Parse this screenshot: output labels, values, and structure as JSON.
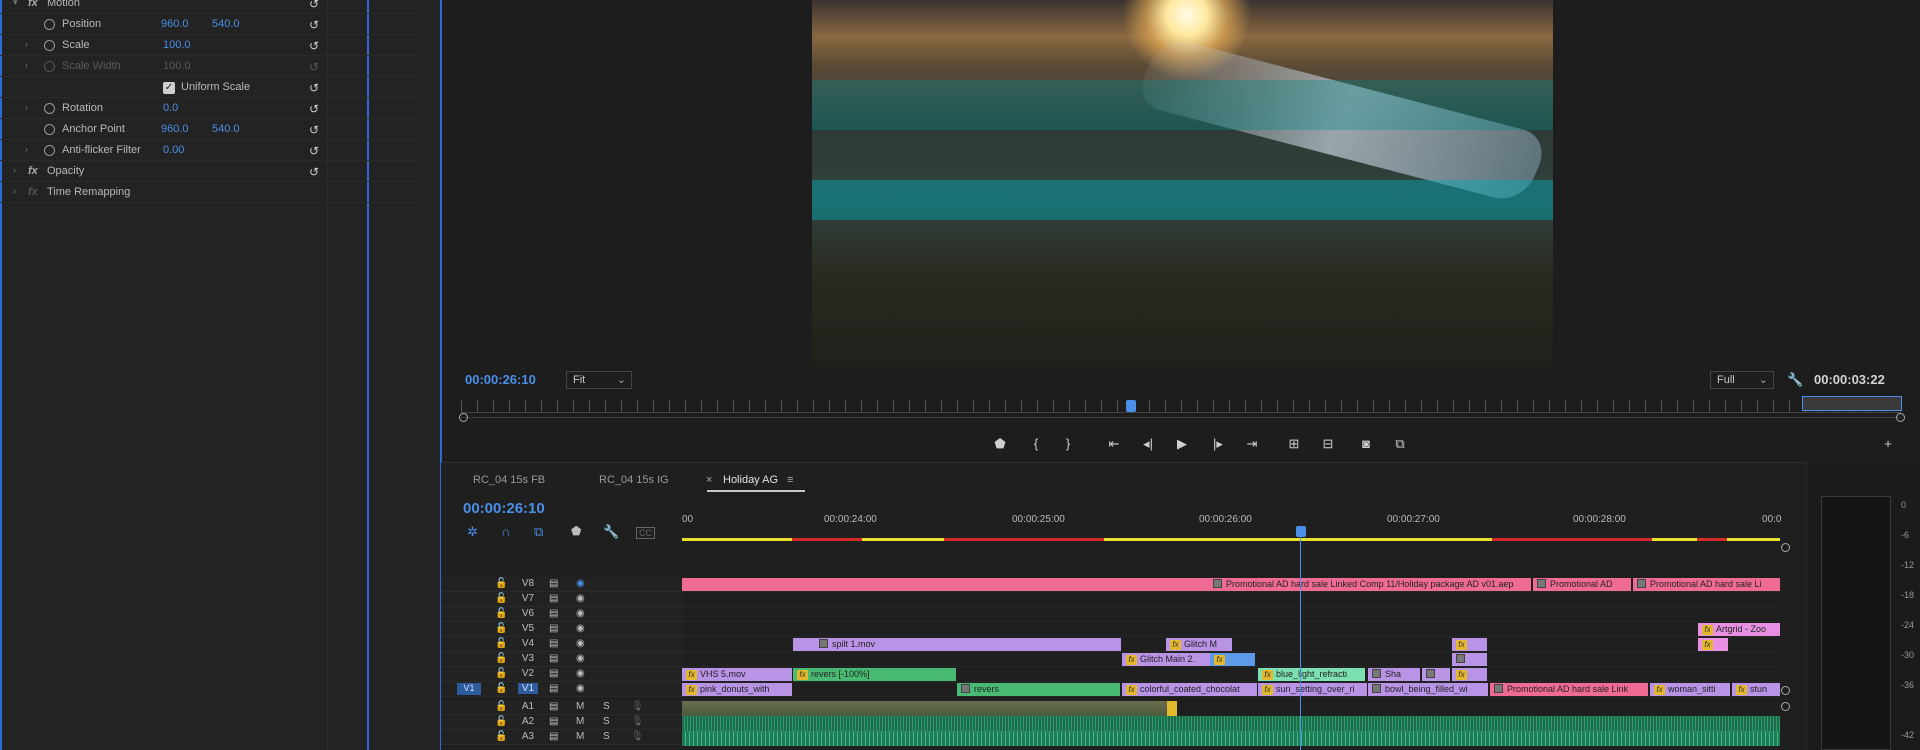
{
  "effect_controls": {
    "motion": {
      "label": "Motion"
    },
    "properties": [
      {
        "label": "Position",
        "value1": "960.0",
        "value2": "540.0"
      },
      {
        "label": "Scale",
        "value1": "100.0"
      },
      {
        "label": "Scale Width",
        "value1": "100.0"
      },
      {
        "label": "Uniform Scale"
      },
      {
        "label": "Rotation",
        "value1": "0.0"
      },
      {
        "label": "Anchor Point",
        "value1": "960.0",
        "value2": "540.0"
      },
      {
        "label": "Anti-flicker Filter",
        "value1": "0.00"
      }
    ],
    "opacity_label": "Opacity",
    "time_remap_label": "Time Remapping"
  },
  "program": {
    "current_tc": "00:00:26:10",
    "fit_select": "Fit",
    "quality_select": "Full",
    "duration_tc": "00:00:03:22"
  },
  "sequence": {
    "tabs": [
      "RC_04 15s FB",
      "RC_04 15s IG",
      "Holiday AG"
    ],
    "tab_close": "×",
    "tab_menu": "≡",
    "current_tc": "00:00:26:10",
    "ruler_labels": [
      "00",
      "00:00:24:00",
      "00:00:25:00",
      "00:00:26:00",
      "00:00:27:00",
      "00:00:28:00",
      "00:0"
    ],
    "video_tracks": [
      "V8",
      "V7",
      "V6",
      "V5",
      "V4",
      "V3",
      "V2",
      "V1"
    ],
    "audio_tracks": [
      "A1",
      "A2",
      "A3"
    ],
    "src_patch": "V1",
    "m_label": "M",
    "s_label": "S",
    "fx_label": "fx",
    "clips": {
      "v8a": "Promotional AD hard sale Linked Comp 11/Holiday package AD v01.aep",
      "v8b": "Promotional AD",
      "v8c": "Promotional AD hard sale Li",
      "v5a": "Artgrid - Zoo",
      "v4a": "spilt 1.mov",
      "v4b": "Glitch M",
      "v3a": "Glitch Main 2.",
      "v2a": "VHS 5.mov",
      "v2b": "revers [-100%]",
      "v2c": "blue_light_refracti",
      "v2d": "Sha",
      "v1a": "pink_donuts_with",
      "v1b": "revers",
      "v1c": "colorful_coated_chocolat",
      "v1d": "sun_setting_over_ri",
      "v1e": "bowl_being_filled_wi",
      "v1f": "Promotional AD hard sale Link",
      "v1g": "woman_sitti",
      "v1h": "stun"
    }
  },
  "meter": {
    "labels": [
      "0",
      "-6",
      "-12",
      "-18",
      "-24",
      "-30",
      "-36",
      "-42"
    ]
  },
  "colors": {
    "accent_blue": "#4a8fe8",
    "clip_pink": "#f06b93",
    "clip_purple": "#b893e6",
    "clip_green": "#49ba74",
    "timeline_yellow": "#e8e02a",
    "timeline_red": "#d62a2a"
  }
}
